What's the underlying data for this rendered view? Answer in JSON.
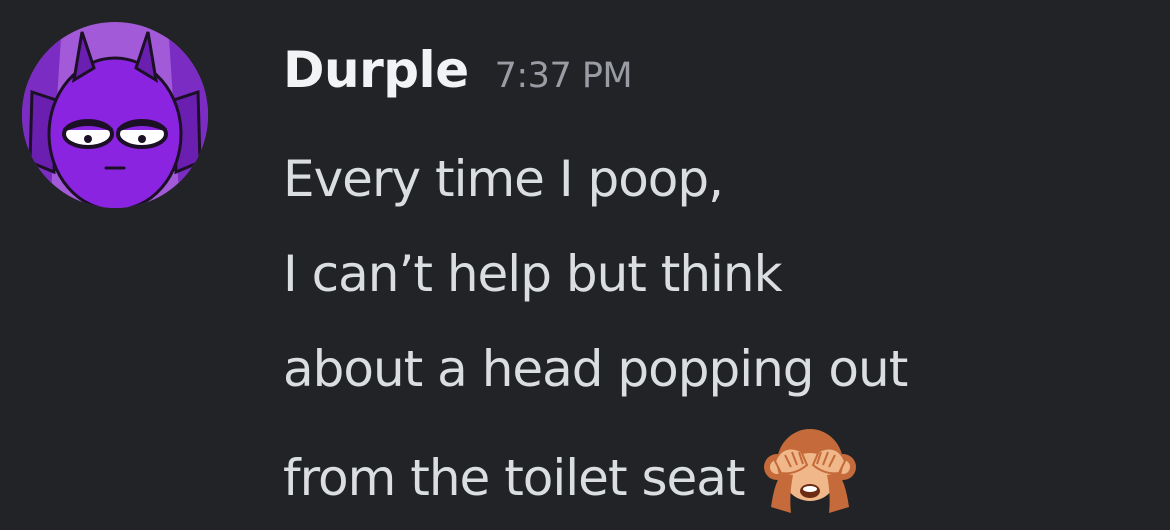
{
  "message": {
    "author": "Durple",
    "timestamp": "7:37 PM",
    "lines": [
      "Every time I poop,",
      "I can’t help but think",
      "about a head popping out",
      "from the toilet seat"
    ],
    "emoji": "see-no-evil-monkey"
  },
  "colors": {
    "background": "#222327",
    "author": "#f2f3f5",
    "timestamp": "#9a9ca3",
    "message_text": "#dbdee1",
    "avatar_purple": "#8a2be2"
  }
}
